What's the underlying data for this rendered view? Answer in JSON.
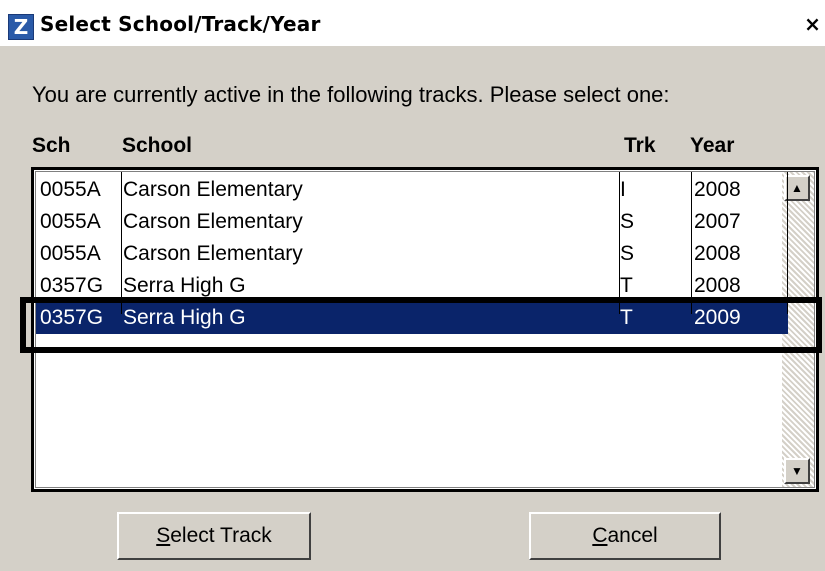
{
  "window": {
    "title": "Select School/Track/Year",
    "icon": "z-app-icon",
    "close_label": "×"
  },
  "prompt": "You are currently active in the following tracks.  Please select one:",
  "columns": {
    "sch": "Sch",
    "school": "School",
    "trk": "Trk",
    "year": "Year"
  },
  "rows": [
    {
      "sch": "0055A",
      "school": "Carson Elementary",
      "trk": "I",
      "year": "2008"
    },
    {
      "sch": "0055A",
      "school": "Carson Elementary",
      "trk": "S",
      "year": "2007"
    },
    {
      "sch": "0055A",
      "school": "Carson Elementary",
      "trk": "S",
      "year": "2008"
    },
    {
      "sch": "0357G",
      "school": "Serra High G",
      "trk": "T",
      "year": "2008"
    },
    {
      "sch": "0357G",
      "school": "Serra High G",
      "trk": "T",
      "year": "2009"
    }
  ],
  "selected_row": 4,
  "buttons": {
    "select_track": {
      "mnemonic": "S",
      "rest": "elect Track"
    },
    "cancel": {
      "mnemonic": "C",
      "rest": "ancel"
    }
  },
  "colors": {
    "face": "#d4d0c8",
    "selection": "#0a246a",
    "highlight_border": "#000000"
  }
}
